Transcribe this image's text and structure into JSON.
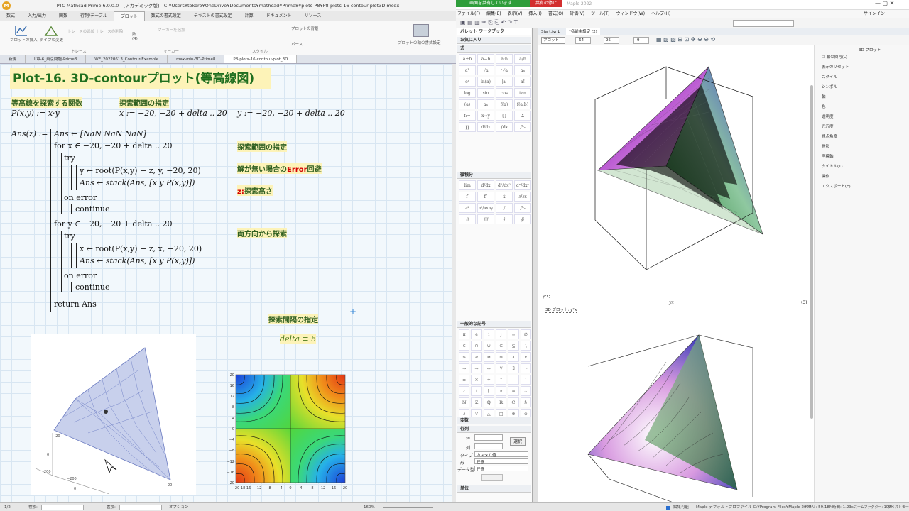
{
  "mathcad": {
    "title": "PTC Mathcad Prime 6.0.0.0 - [アカデミック版] - C:¥Users¥tokoro¥OneDrive¥Documents¥mathcad¥Prime8¥plots-P8¥P8-plots-16-contour-plot3D.mcdx",
    "ribbon_tabs": [
      "数式",
      "入力/出力",
      "関数",
      "行列/テーブル",
      "プロット",
      "数式の書式設定",
      "テキストの書式設定",
      "計算",
      "ドキュメント",
      "リソース"
    ],
    "ribbon_groups": [
      "トレース",
      "マーカー",
      "スタイル"
    ],
    "ribbon_buttons": [
      "プロットの挿入",
      "タイプの変更",
      "トレースの追加",
      "トレースの削除",
      "数",
      "(4)",
      "プロットの背景",
      "パース",
      "プロットの軸の書式設定",
      "マーカーを追加"
    ],
    "doc_tabs": [
      "新規",
      "II章-6_東京問題-Prime8",
      "WE_20220613_Contour-Example",
      "max-min-3D-Prime8",
      "P8-plots-16-contour-plot_3D"
    ],
    "heading": "Plot-16. 3D-contourプロット(等高線図)",
    "label_func": "等高線を探索する関数",
    "label_range": "探索範囲の指定",
    "def_P": "P(x,y) := x·y",
    "def_x": "x := −20, −20 + delta .. 20",
    "def_y": "y := −20, −20 + delta .. 20",
    "ans_lines": [
      "Ans(z) :=",
      "Ans ← [NaN  NaN  NaN]",
      "for x ∈ −20, −20 + delta .. 20",
      "try",
      "y ← root(P(x,y) − z, y, −20, 20)",
      "Ans ← stack(Ans, [x  y  P(x,y)])",
      "on error",
      "continue",
      "for y ∈ −20, −20 + delta .. 20",
      "try",
      "x ← root(P(x,y) − z, x, −20, 20)",
      "Ans ← stack(Ans, [x  y  P(x,y)])",
      "on error",
      "continue",
      "return Ans"
    ],
    "note1": "探索範囲の指定",
    "note2_a": "解が無い場合の",
    "note2_b": "Error",
    "note2_c": "回避",
    "note3_a": "z:",
    "note3_b": "探索高さ",
    "note4": "両方向から探索",
    "note5": "探索間隔の指定",
    "delta": "delta ≡ 5",
    "contour_ticks_y": [
      "20",
      "18",
      "16",
      "14",
      "12",
      "10",
      "8",
      "6",
      "4",
      "2",
      "0",
      "−2",
      "−4",
      "−6",
      "−8",
      "−10",
      "−12",
      "−14",
      "−16",
      "−18",
      "−20"
    ],
    "contour_ticks_x": [
      "−20",
      "−18",
      "−16",
      "−12",
      "−8",
      "−4",
      "0",
      "4",
      "8",
      "12",
      "16",
      "20"
    ],
    "surf_axis_labels": [
      "200",
      "0",
      "−200",
      "20",
      "−20",
      "20",
      "0"
    ],
    "status": [
      "1/2",
      "検索:",
      "置換:",
      "オプション",
      "160%"
    ]
  },
  "maple": {
    "title": "Maple 2022",
    "share_label": "画面を共有しています",
    "stop_label": "共有の停止",
    "menu": [
      "ファイル(F)",
      "編集(E)",
      "表示(V)",
      "挿入(I)",
      "書式(O)",
      "評価(V)",
      "ツール(T)",
      "ウィンドウ(W)",
      "ヘルプ(H)"
    ],
    "signin": "サインイン",
    "palette_header": "パレット  ワークブック",
    "palette_sections": [
      "お気に入り",
      "式",
      "微積分",
      "一般的な記号",
      "変数",
      "行列",
      "単位"
    ],
    "matrix_labels": [
      "行",
      "列",
      "タイプ",
      "形",
      "データ型"
    ],
    "matrix_values": [
      "カスタム値",
      "任意",
      "任意"
    ],
    "matrix_button": "選択",
    "doc_tabs": [
      "Start.ivnb",
      "*名前未設定 (2)"
    ],
    "plot_dropdown": "プロット",
    "view_values": [
      "-64",
      "95",
      "-9"
    ],
    "ctx_header": "3D プロット",
    "ctx_items": [
      "軸の関与(L)",
      "表示のリセット",
      "スタイル",
      "シンボル",
      "軸",
      "色",
      "透明度",
      "光沢度",
      "視点角度",
      "投影",
      "座標軸",
      "タイトル(T)",
      "操作",
      "エクスポート(E)"
    ],
    "label_yx": "y·x;",
    "center_label": "yx",
    "eq_num": "(3)",
    "plot_label": "3D プロット: y*x",
    "status": [
      "編集可能",
      "Maple デフォルトプロファイル  C:¥Program Files¥Maple 2022",
      "メモリ: 59.18M",
      "時間: 1.23s",
      "ズームファクター: 100%",
      "テキストモード"
    ]
  }
}
